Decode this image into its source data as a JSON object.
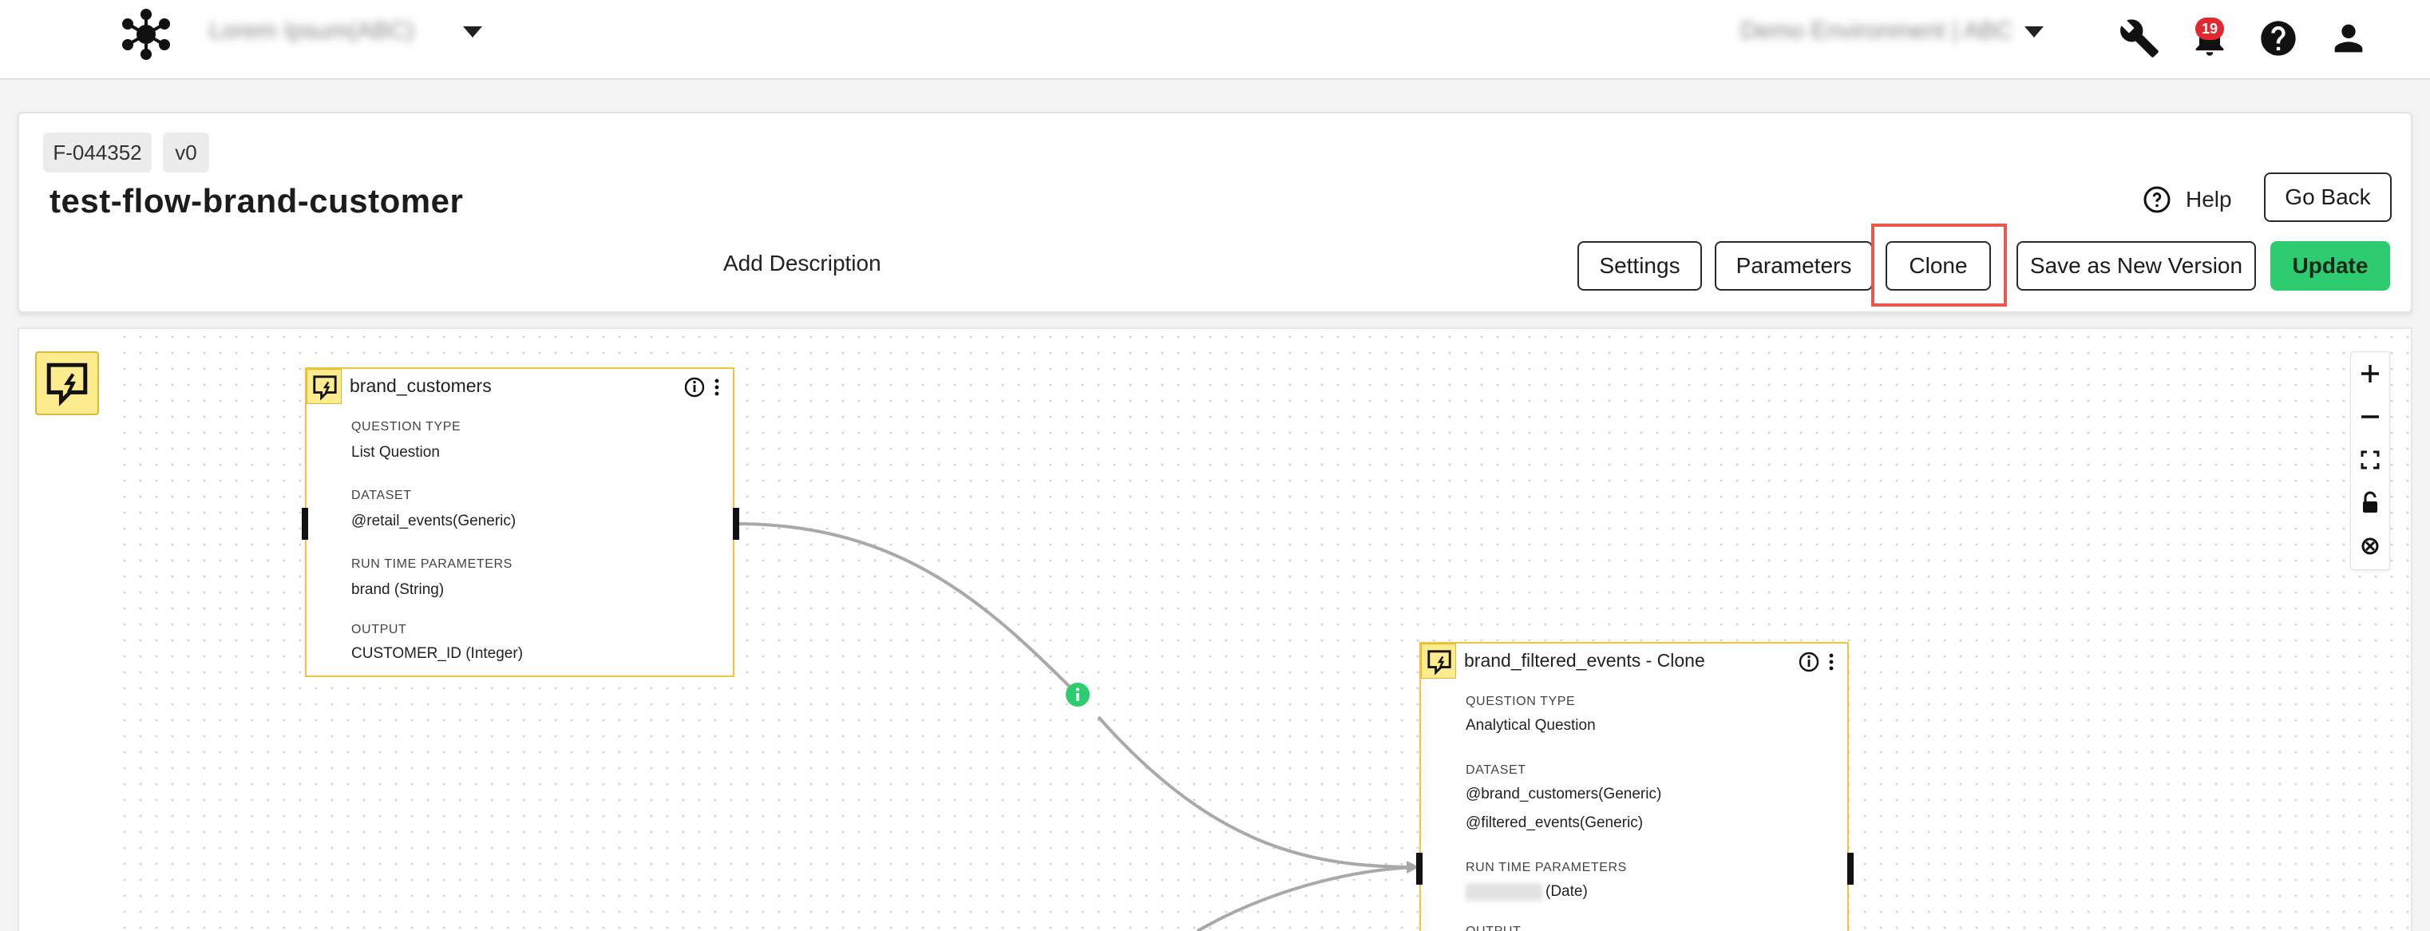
{
  "topbar": {
    "org_selector_text": "Lorem Ipsum(ABC)",
    "env_selector_text": "Demo Environment | ABC",
    "notification_count": "19"
  },
  "flow": {
    "id": "F-044352",
    "version": "v0",
    "title": "test-flow-brand-customer",
    "add_description": "Add Description"
  },
  "actions": {
    "help": "Help",
    "go_back": "Go Back",
    "settings": "Settings",
    "parameters": "Parameters",
    "clone": "Clone",
    "save_new_version": "Save as New Version",
    "update": "Update"
  },
  "nodes": [
    {
      "title": "brand_customers",
      "fields": [
        {
          "label": "QUESTION TYPE",
          "values": [
            "List Question"
          ]
        },
        {
          "label": "DATASET",
          "values": [
            "@retail_events(Generic)"
          ]
        },
        {
          "label": "RUN TIME PARAMETERS",
          "values": [
            "brand (String)"
          ]
        },
        {
          "label": "OUTPUT",
          "values": [
            "CUSTOMER_ID (Integer)"
          ]
        }
      ]
    },
    {
      "title": "brand_filtered_events - Clone",
      "fields": [
        {
          "label": "QUESTION TYPE",
          "values": [
            "Analytical Question"
          ]
        },
        {
          "label": "DATASET",
          "values": [
            "@brand_customers(Generic)",
            "@filtered_events(Generic)"
          ]
        },
        {
          "label": "RUN TIME PARAMETERS",
          "values": [
            "(Date)"
          ]
        },
        {
          "label": "OUTPUT",
          "values": []
        }
      ]
    }
  ],
  "colors": {
    "accent_green": "#2ecc71",
    "node_border": "#f0c43c",
    "node_icon_bg": "#fcec8e",
    "highlight": "#e8584d",
    "badge_red": "#e0282e"
  },
  "icons": [
    "network-logo-icon",
    "wrench-icon",
    "bell-icon",
    "help-circle-icon",
    "user-icon",
    "question-node-icon",
    "info-icon",
    "more-vertical-icon",
    "zoom-in-icon",
    "zoom-out-icon",
    "fit-view-icon",
    "lock-icon",
    "cancel-icon"
  ]
}
